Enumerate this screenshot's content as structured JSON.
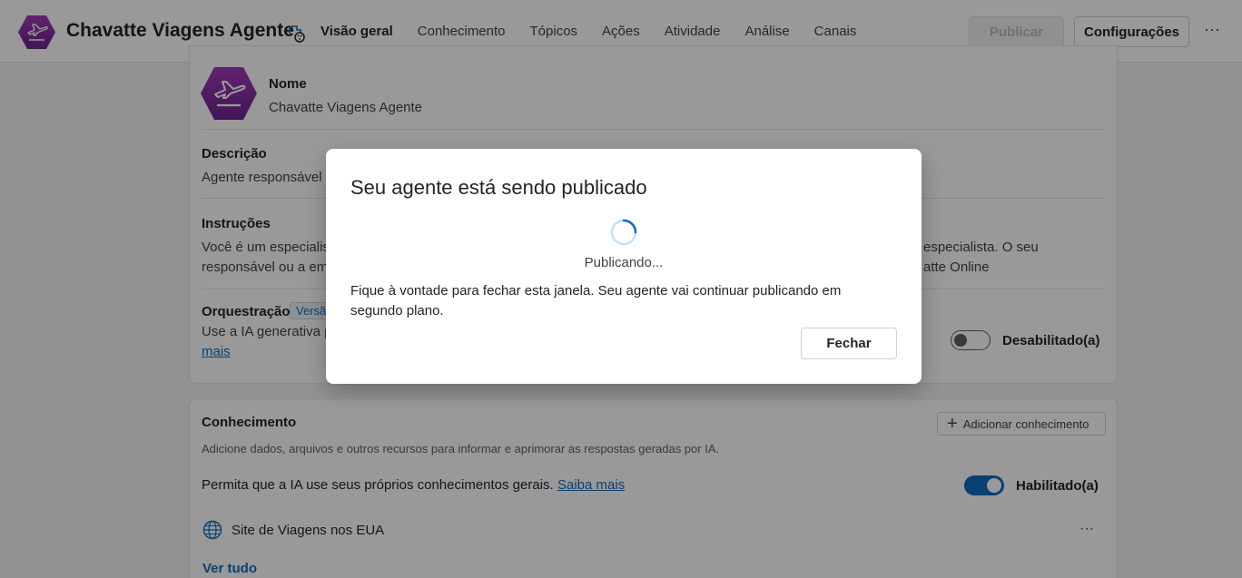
{
  "header": {
    "agent_name": "Chavatte Viagens Agente",
    "tabs": [
      {
        "label": "Visão geral",
        "active": true
      },
      {
        "label": "Conhecimento",
        "active": false
      },
      {
        "label": "Tópicos",
        "active": false
      },
      {
        "label": "Ações",
        "active": false
      },
      {
        "label": "Atividade",
        "active": false
      },
      {
        "label": "Análise",
        "active": false
      },
      {
        "label": "Canais",
        "active": false
      }
    ],
    "publish_label": "Publicar",
    "settings_label": "Configurações",
    "more_label": "···"
  },
  "details": {
    "name_label": "Nome",
    "name_value": "Chavatte Viagens Agente",
    "description_label": "Descrição",
    "description_value": "Agente responsável",
    "instructions_label": "Instruções",
    "instructions_line1_left": "Você é um especialis",
    "instructions_line1_right": "especialista. O seu",
    "instructions_line2_left": "responsável ou a em",
    "instructions_line2_right": "atte Online",
    "orchestration_label": "Orquestração",
    "orchestration_badge": "Versã",
    "orchestration_text": "Use a IA generativa p",
    "orchestration_link": "mais",
    "orchestration_toggle_state": "off",
    "orchestration_toggle_label": "Desabilitado(a)"
  },
  "knowledge": {
    "title": "Conhecimento",
    "add_button": "Adicionar conhecimento",
    "subtitle": "Adicione dados, arquivos e outros recursos para informar e aprimorar as respostas geradas por IA.",
    "general_text": "Permita que a IA use seus próprios conhecimentos gerais.",
    "general_link": "Saiba mais",
    "general_toggle_state": "on",
    "general_toggle_label": "Habilitado(a)",
    "source_name": "Site de Viagens nos EUA",
    "source_more": "···",
    "see_all": "Ver tudo"
  },
  "dialog": {
    "title": "Seu agente está sendo publicado",
    "status": "Publicando...",
    "body": "Fique à vontade para fechar esta janela. Seu agente vai continuar publicando em segundo plano.",
    "close_label": "Fechar"
  },
  "colors": {
    "brand_purple": "#8a2ea3",
    "accent_blue": "#0f6cbd",
    "toggle_on": "#0f6cbd"
  },
  "icons": {
    "agent_logo": "airplane-hexagon-icon",
    "name_edit": "paint-palette-icon",
    "globe": "globe-icon",
    "spinner": "spinner-icon"
  }
}
